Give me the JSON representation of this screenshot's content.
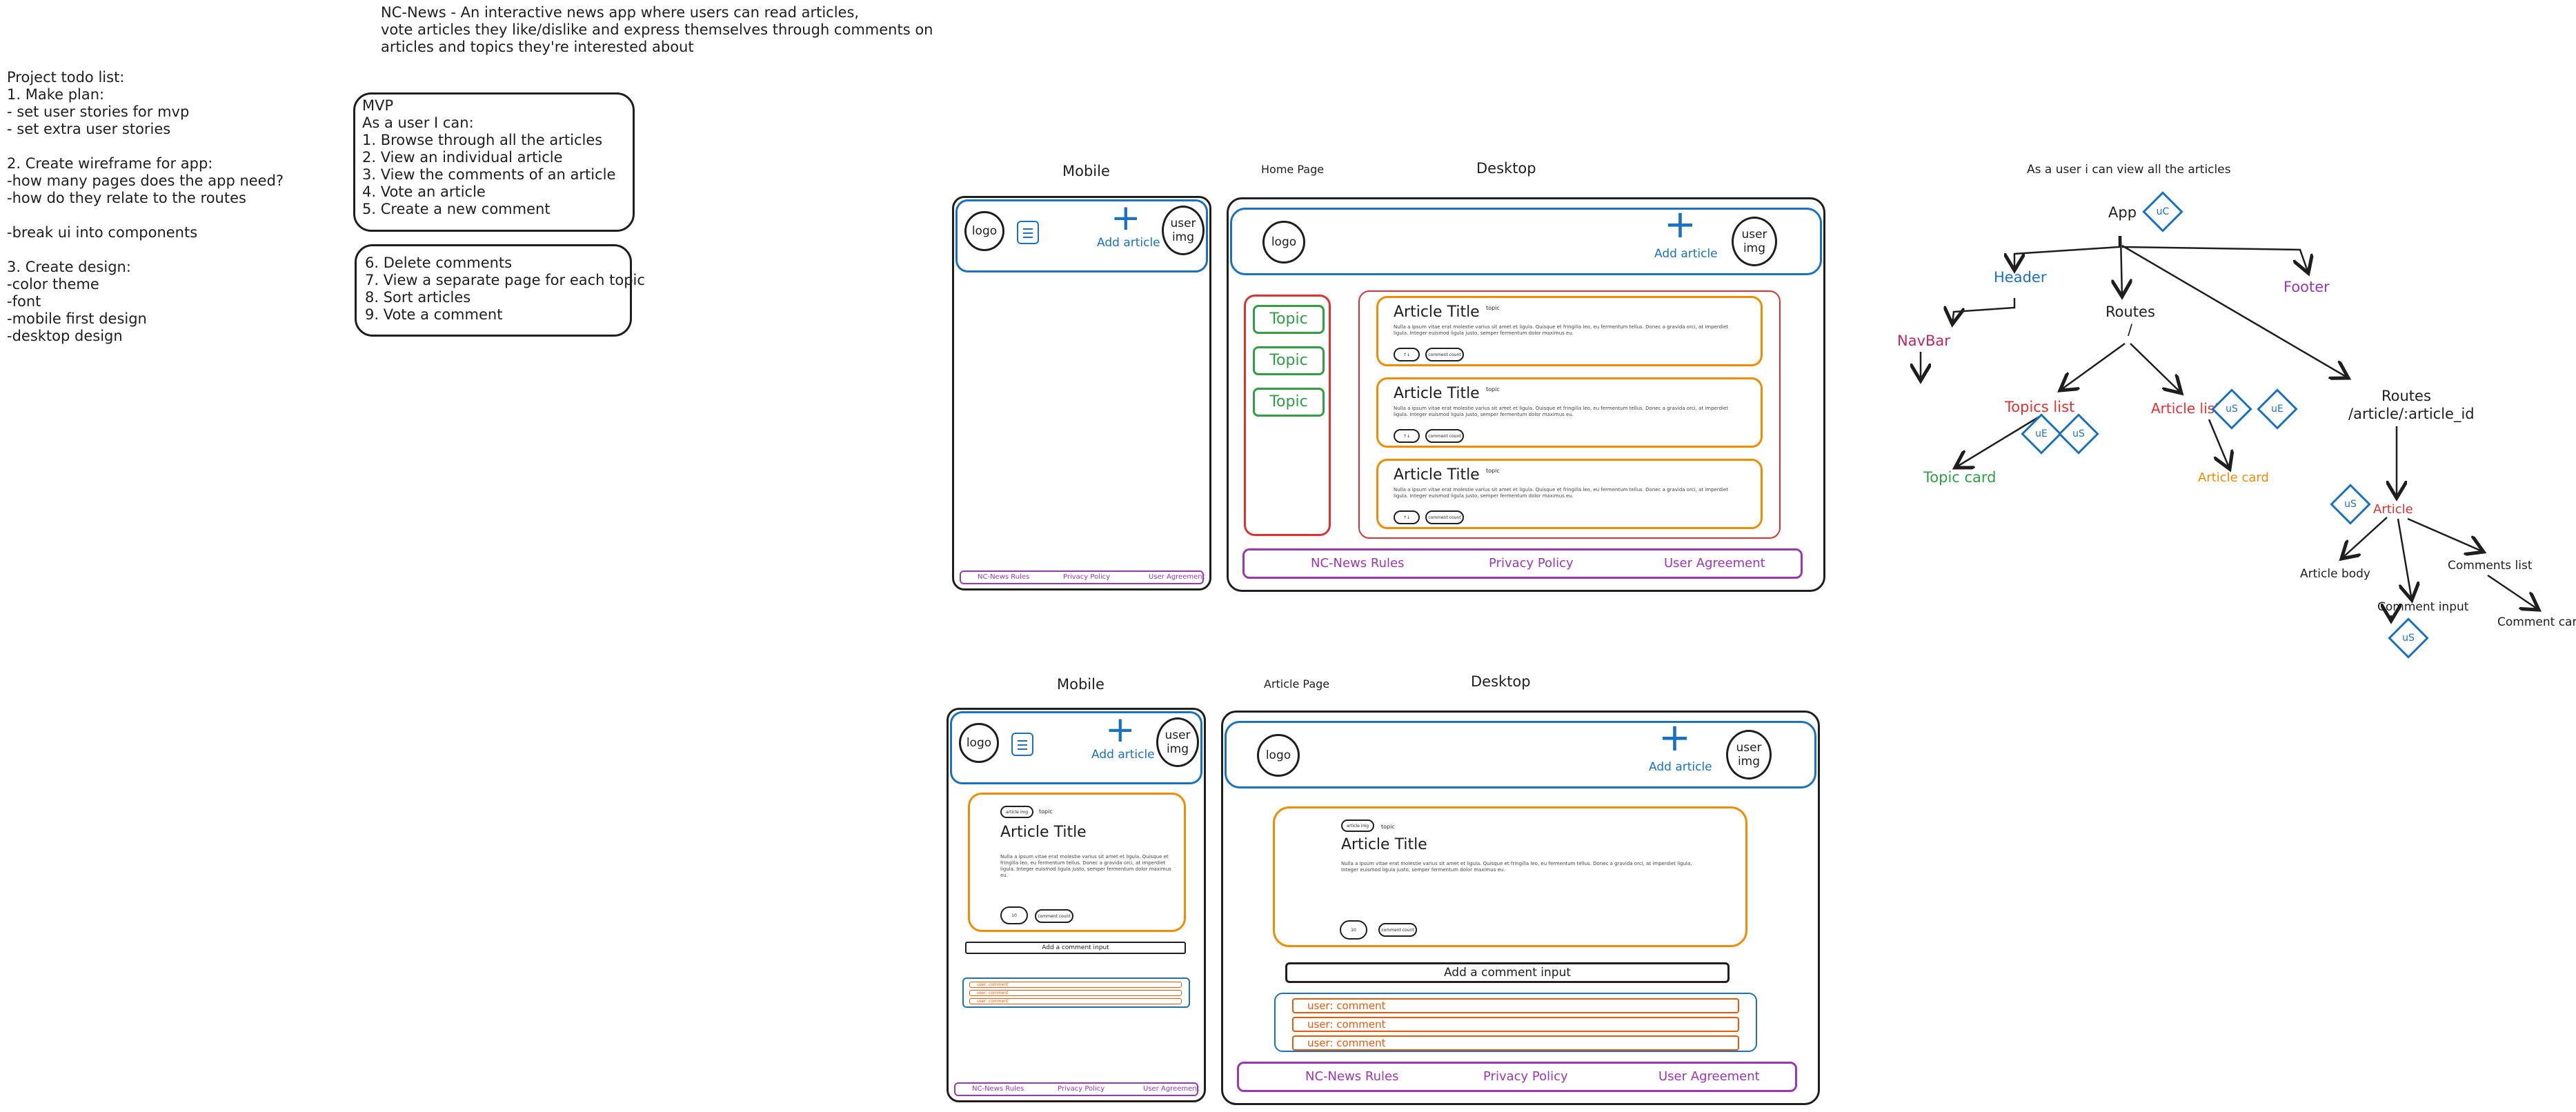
{
  "description": {
    "lines": [
      "NC-News - An interactive news app where users can read articles,",
      "vote articles they like/dislike and express themselves through comments on",
      "articles and topics they're interested about"
    ]
  },
  "todo": {
    "lines": [
      "Project todo list:",
      "1. Make plan:",
      "- set user stories for mvp",
      "- set extra user stories",
      "",
      "2. Create wireframe for app:",
      "-how many pages does the app need?",
      "-how do they relate to the routes",
      "",
      "-break ui into components",
      "",
      "3. Create design:",
      "-color theme",
      "-font",
      "-mobile first design",
      "-desktop design"
    ]
  },
  "mvp": {
    "lines": [
      "MVP",
      "As a user I can:",
      "1. Browse through all the articles",
      "2. View an individual article",
      "3. View the comments of an article",
      "4. Vote an article",
      "5. Create a new comment"
    ]
  },
  "extra": {
    "lines": [
      "6. Delete comments",
      "7. View a separate page for each topic",
      "8. Sort articles",
      "9. Vote a comment"
    ]
  },
  "wireframe": {
    "mobile_label": "Mobile",
    "desktop_label": "Desktop",
    "home_page_label": "Home Page",
    "article_page_label": "Article Page",
    "logo": "logo",
    "user_img": "user img",
    "add_article": "Add article",
    "topic": "Topic",
    "article_title": "Article Title",
    "topic_tag": "topic",
    "lorem": "Nulla a ipsum vitae erat molestie varius sit amet et ligula. Quisque et fringilla leo, eu fermentum tellus. Donec a gravida orci, at imperdiet ligula. Integer euismod ligula justo, semper fermentum dolor maximus eu.",
    "vote_short": "↑↓",
    "vote_count": "10",
    "comment_count": "comment count",
    "article_img": "article img",
    "add_comment_input": "Add a comment input",
    "user_comment": "user: comment",
    "footer": [
      "NC-News Rules",
      "Privacy Policy",
      "User Agreement"
    ]
  },
  "tree": {
    "title": "As a user i can view all the articles",
    "app": "App",
    "header": "Header",
    "footer": "Footer",
    "navbar": "NavBar",
    "routes": "Routes",
    "routes_root": "/",
    "topics_list": "Topics list",
    "article_list": "Article list",
    "topic_card": "Topic card",
    "article_card": "Article card",
    "routes_article": "Routes",
    "routes_article_path": "/article/:article_id",
    "article": "Article",
    "article_body": "Article body",
    "comments_list": "Comments list",
    "comment_input": "Comment input",
    "comment_card": "Comment card",
    "badge_uc": "uC",
    "badge_us": "uS",
    "badge_ue": "uE"
  },
  "colors": {
    "ink": "#1e1e1e",
    "blue": "#1971c2",
    "green": "#2f9e44",
    "red": "#e03131",
    "orange": "#f08c00",
    "purple": "#9c36b5",
    "comment_orange": "#e8590c"
  }
}
